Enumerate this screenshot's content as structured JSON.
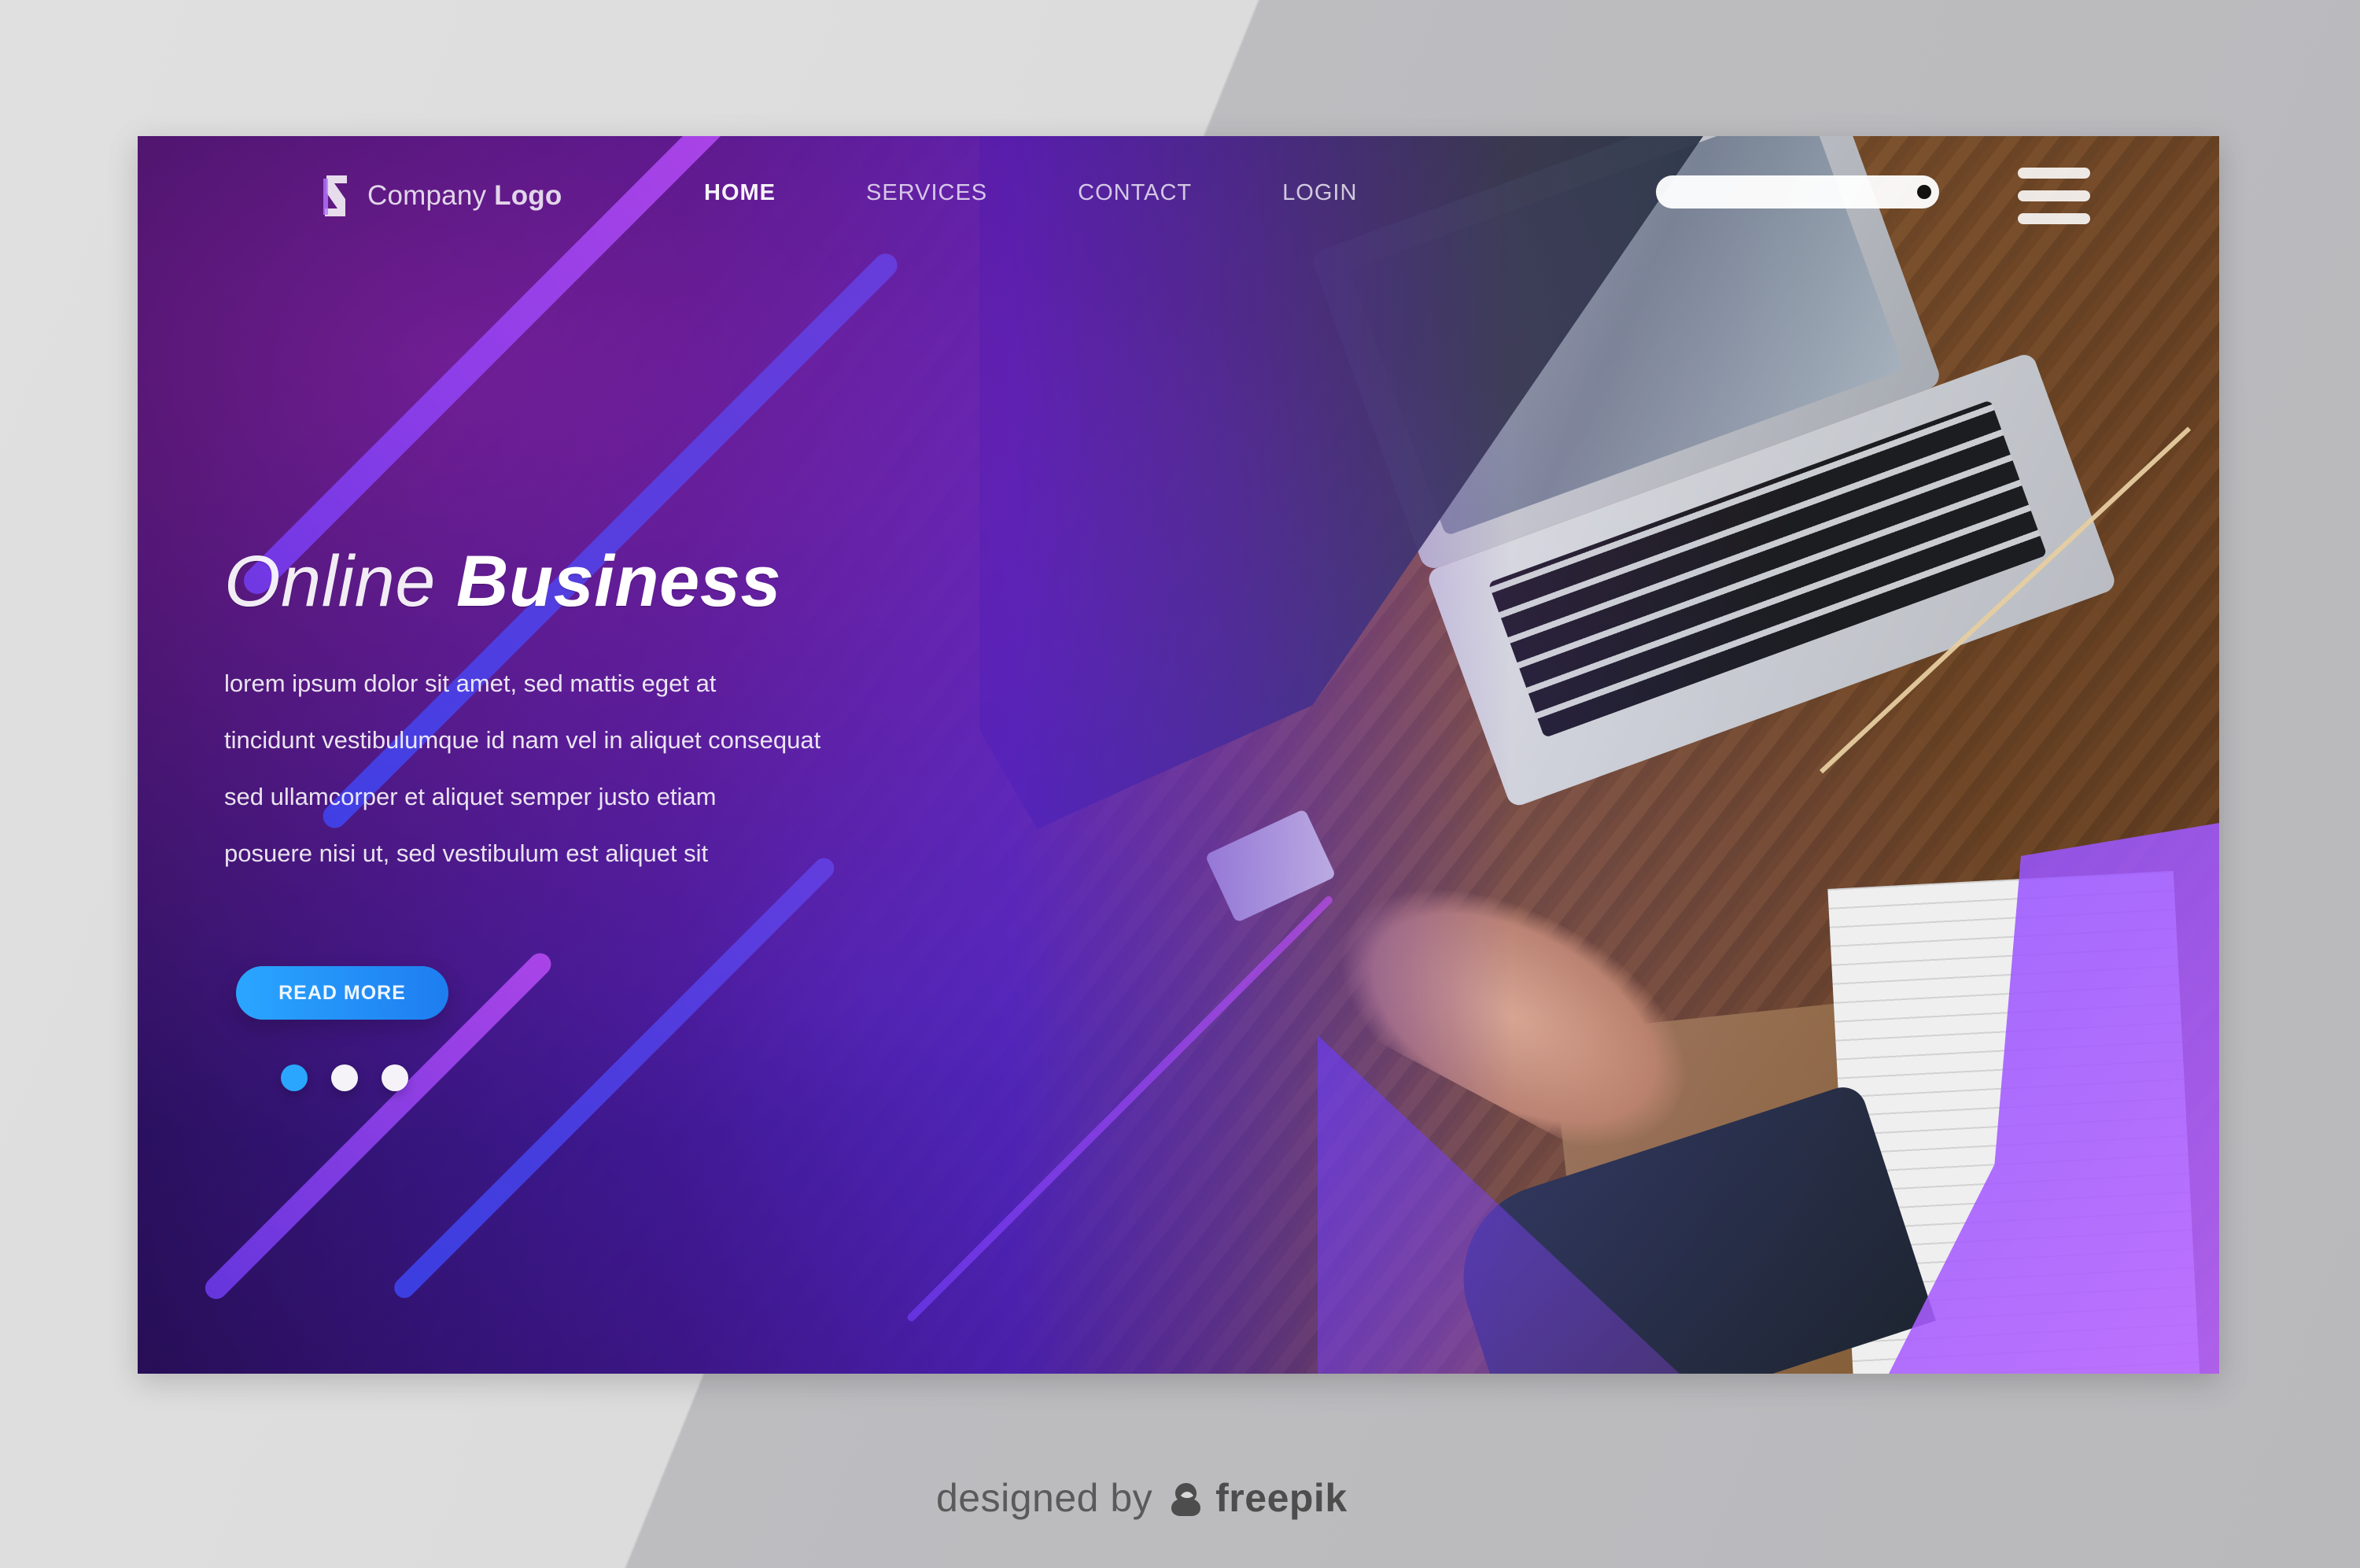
{
  "nav": {
    "logo_prefix": "Company",
    "logo_bold": "Logo",
    "items": [
      "HOME",
      "SERVICES",
      "CONTACT",
      "LOGIN"
    ]
  },
  "search": {
    "placeholder": ""
  },
  "hero": {
    "title_light": "Online",
    "title_bold": "Business",
    "paragraph_lines": [
      "lorem ipsum dolor sit amet, sed mattis eget at",
      "tincidunt vestibulumque id nam vel in aliquet consequat",
      "sed ullamcorper et aliquet semper justo etiam",
      "posuere nisi ut, sed vestibulum est aliquet sit"
    ],
    "cta_label": "READ MORE"
  },
  "pager": {
    "count": 3,
    "active_index": 0
  },
  "watermark": {
    "prefix": "designed by",
    "brand": "freepik"
  },
  "colors": {
    "overlay_purple": "#3a12a8",
    "accent_blue": "#2aa6ff",
    "accent_purple": "#9b52ff",
    "background_gray": "#dcdcdc"
  },
  "icons": {
    "logo": "logo-mark-icon",
    "menu": "hamburger-icon",
    "search": "search-field",
    "watermark_brand": "freepik-icon"
  }
}
